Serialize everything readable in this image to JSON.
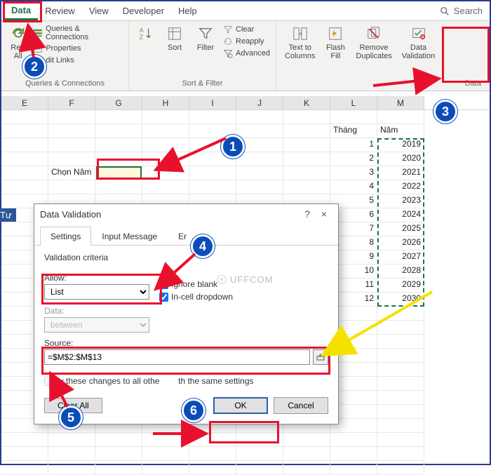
{
  "tabs": {
    "data": "Data",
    "review": "Review",
    "view": "View",
    "developer": "Developer",
    "help": "Help",
    "search": "Search"
  },
  "ribbon": {
    "refresh": "Refr\nAll",
    "queries": "Queries & Connections",
    "properties": "Properties",
    "editlinks": "dit Links",
    "group_qc": "Queries & Connections",
    "sort": "Sort",
    "filter": "Filter",
    "clear": "Clear",
    "reapply": "Reapply",
    "advanced": "Advanced",
    "group_sf": "Sort & Filter",
    "ttc": "Text to\nColumns",
    "flash": "Flash\nFill",
    "remdup": "Remove\nDuplicates",
    "dval": "Data\nValidation",
    "group_dt": "Data"
  },
  "columns": [
    "E",
    "F",
    "G",
    "H",
    "I",
    "J",
    "K",
    "L",
    "M"
  ],
  "labels": {
    "chon_nam": "Chọn Năm",
    "thur": "ứ Tư",
    "thang": "Tháng",
    "nam": "Năm"
  },
  "months": [
    1,
    2,
    3,
    4,
    5,
    6,
    7,
    8,
    9,
    10,
    11,
    12
  ],
  "years": [
    2019,
    2020,
    2021,
    2022,
    2023,
    2024,
    2025,
    2026,
    2027,
    2028,
    2029,
    2030
  ],
  "dialog": {
    "title": "Data Validation",
    "help": "?",
    "close": "×",
    "tab_settings": "Settings",
    "tab_input": "Input Message",
    "tab_error": "Er",
    "criteria": "Validation criteria",
    "allow": "Allow:",
    "allow_val": "List",
    "data": "Data:",
    "data_val": "between",
    "ignore": "Ignore blank",
    "incell": "In-cell dropdown",
    "source": "Source:",
    "source_val": "=$M$2:$M$13",
    "apply": "ly these changes to all othe",
    "apply2": "th the same settings",
    "clearall": "Clear All",
    "ok": "OK",
    "cancel": "Cancel"
  },
  "watermark": "UFFCOM",
  "callouts": {
    "c1": "1",
    "c2": "2",
    "c3": "3",
    "c4": "4",
    "c5": "5",
    "c6": "6"
  }
}
